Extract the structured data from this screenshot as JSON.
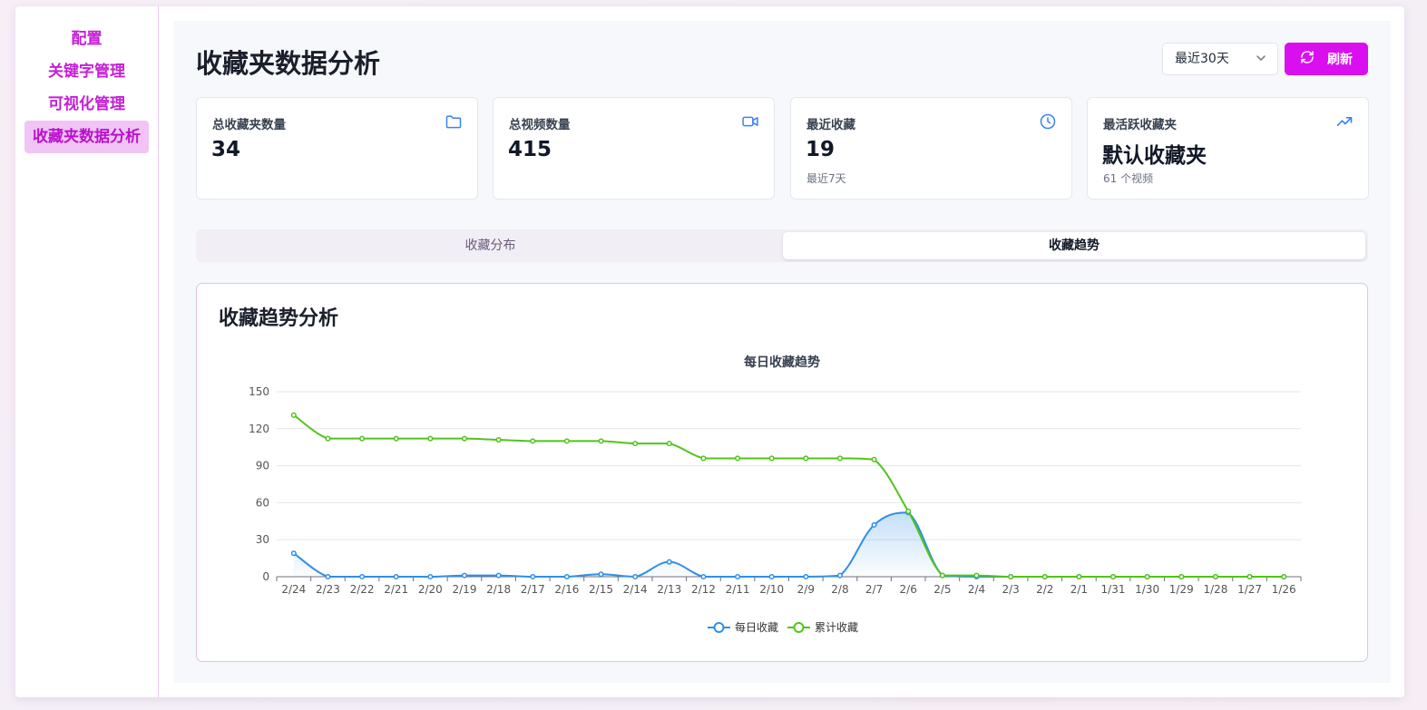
{
  "sidebar": {
    "items": [
      {
        "label": "配置"
      },
      {
        "label": "关键字管理"
      },
      {
        "label": "可视化管理"
      },
      {
        "label": "收藏夹数据分析"
      }
    ]
  },
  "header": {
    "title": "收藏夹数据分析",
    "range_value": "最近30天",
    "refresh_label": "刷新"
  },
  "stats": {
    "total_folders": {
      "label": "总收藏夹数量",
      "value": "34",
      "icon": "folder-icon"
    },
    "total_videos": {
      "label": "总视频数量",
      "value": "415",
      "icon": "video-icon"
    },
    "recent": {
      "label": "最近收藏",
      "value": "19",
      "sub": "最近7天",
      "icon": "clock-icon"
    },
    "most_active": {
      "label": "最活跃收藏夹",
      "value": "默认收藏夹",
      "sub": "61 个视频",
      "icon": "trending-up-icon"
    }
  },
  "tabs": [
    {
      "label": "收藏分布",
      "active": false
    },
    {
      "label": "收藏趋势",
      "active": true
    }
  ],
  "panel": {
    "title": "收藏趋势分析"
  },
  "colors": {
    "accent": "#d90ff0",
    "daily": "#2f8fe8",
    "cumulative": "#52c41a",
    "icon_blue": "#3b82f6"
  },
  "chart_data": {
    "type": "line",
    "title": "每日收藏趋势",
    "categories": [
      "2/24",
      "2/23",
      "2/22",
      "2/21",
      "2/20",
      "2/19",
      "2/18",
      "2/17",
      "2/16",
      "2/15",
      "2/14",
      "2/13",
      "2/12",
      "2/11",
      "2/10",
      "2/9",
      "2/8",
      "2/7",
      "2/6",
      "2/5",
      "2/4",
      "2/3",
      "2/2",
      "2/1",
      "1/31",
      "1/30",
      "1/29",
      "1/28",
      "1/27",
      "1/26"
    ],
    "series": [
      {
        "name": "每日收藏",
        "values": [
          19,
          0,
          0,
          0,
          0,
          1,
          1,
          0,
          0,
          2,
          0,
          12,
          0,
          0,
          0,
          0,
          1,
          42,
          52,
          1,
          0,
          0,
          0,
          0,
          0,
          0,
          0,
          0,
          0,
          0
        ]
      },
      {
        "name": "累计收藏",
        "values": [
          131,
          112,
          112,
          112,
          112,
          112,
          111,
          110,
          110,
          110,
          108,
          108,
          96,
          96,
          96,
          96,
          96,
          95,
          53,
          1,
          1,
          0,
          0,
          0,
          0,
          0,
          0,
          0,
          0,
          0
        ]
      }
    ],
    "ylim": [
      0,
      150
    ],
    "yticks": [
      0,
      30,
      60,
      90,
      120,
      150
    ],
    "grid": true,
    "legend": "bottom-center"
  }
}
